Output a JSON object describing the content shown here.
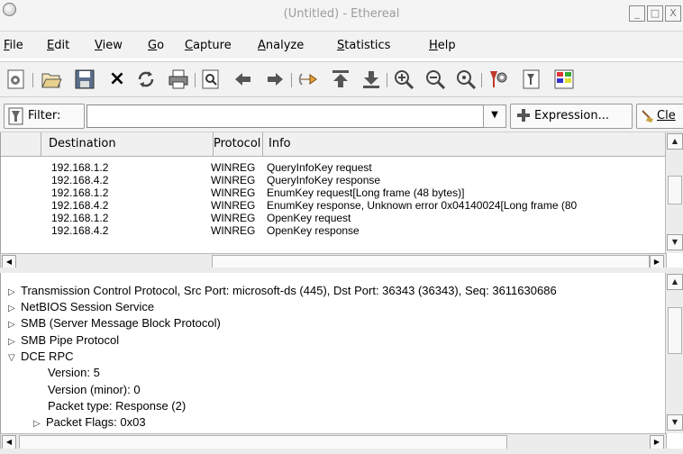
{
  "window": {
    "title": "(Untitled) - Ethereal",
    "buttons": [
      "_",
      "□",
      "X"
    ]
  },
  "menubar": {
    "items": [
      {
        "label": "File",
        "accel": "F"
      },
      {
        "label": "Edit",
        "accel": "E"
      },
      {
        "label": "View",
        "accel": "V"
      },
      {
        "label": "Go",
        "accel": "G"
      },
      {
        "label": "Capture",
        "accel": "C"
      },
      {
        "label": "Analyze",
        "accel": "A"
      },
      {
        "label": "Statistics",
        "accel": "S"
      },
      {
        "label": "Help",
        "accel": "H"
      }
    ]
  },
  "toolbar": {
    "icons": [
      "interfaces-icon",
      "open-icon",
      "save-icon",
      "close-icon",
      "reload-icon",
      "print-icon",
      "find-icon",
      "back-icon",
      "forward-icon",
      "goto-icon",
      "first-packet-icon",
      "last-packet-icon",
      "zoom-in-icon",
      "zoom-out-icon",
      "zoom-normal-icon",
      "capture-filter-icon",
      "display-filter-icon",
      "coloring-rules-icon"
    ],
    "close_glyph": "×"
  },
  "filter": {
    "label": "Filter:",
    "value": "",
    "expression_label": "Expression...",
    "clear_label": "Cle"
  },
  "packet_list": {
    "columns": [
      "Destination",
      "Protocol",
      "Info"
    ],
    "rows": [
      {
        "destination": "192.168.1.2",
        "protocol": "WINREG",
        "info": "QueryInfoKey request"
      },
      {
        "destination": "192.168.4.2",
        "protocol": "WINREG",
        "info": "QueryInfoKey response"
      },
      {
        "destination": "192.168.1.2",
        "protocol": "WINREG",
        "info": "EnumKey request[Long frame (48 bytes)]"
      },
      {
        "destination": "192.168.4.2",
        "protocol": "WINREG",
        "info": "EnumKey response, Unknown error 0x04140024[Long frame (80"
      },
      {
        "destination": "192.168.1.2",
        "protocol": "WINREG",
        "info": "OpenKey request"
      },
      {
        "destination": "192.168.4.2",
        "protocol": "WINREG",
        "info": "OpenKey response"
      }
    ]
  },
  "detail_tree": {
    "rows": [
      {
        "indent": 0,
        "state": "collapsed",
        "text": "Transmission Control Protocol, Src Port: microsoft-ds (445), Dst Port: 36343 (36343), Seq: 3611630686"
      },
      {
        "indent": 0,
        "state": "collapsed",
        "text": "NetBIOS Session Service"
      },
      {
        "indent": 0,
        "state": "collapsed",
        "text": "SMB (Server Message Block Protocol)"
      },
      {
        "indent": 0,
        "state": "collapsed",
        "text": "SMB Pipe Protocol"
      },
      {
        "indent": 0,
        "state": "expanded",
        "text": "DCE RPC"
      },
      {
        "indent": 1,
        "state": "leaf",
        "text": "Version: 5"
      },
      {
        "indent": 1,
        "state": "leaf",
        "text": "Version (minor): 0"
      },
      {
        "indent": 1,
        "state": "leaf",
        "text": "Packet type: Response (2)"
      },
      {
        "indent": 1,
        "state": "collapsed",
        "text": "Packet Flags: 0x03"
      }
    ]
  },
  "glyphs": {
    "collapsed": "▷",
    "expanded": "▽",
    "up": "▲",
    "down": "▼",
    "left": "◀",
    "right": "▶"
  }
}
